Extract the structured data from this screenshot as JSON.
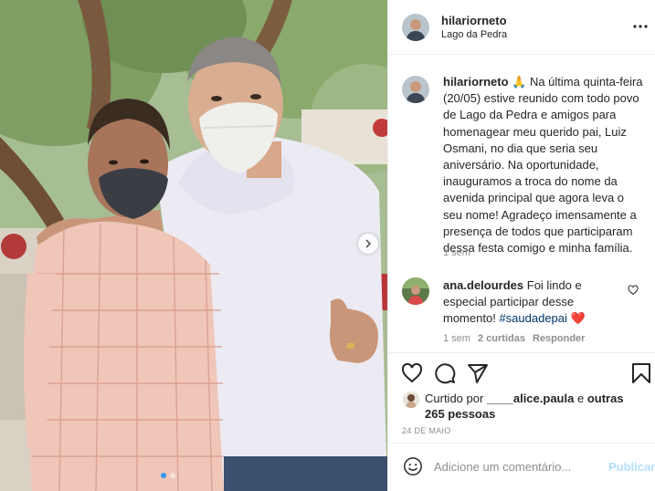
{
  "post": {
    "username": "hilariorneto",
    "location": "Lago da Pedra"
  },
  "caption": {
    "username": "hilariorneto",
    "emoji": "🙏",
    "text": "Na última quinta-feira (20/05) estive reunido com todo povo de Lago da Pedra e amigos para homenagear meu querido pai, Luiz Osmani, no dia que seria seu aniversário. Na oportunidade, inauguramos a troca do nome da avenida principal que agora leva o seu nome! Agradeço imensamente a presença de todos que participaram dessa festa comigo e minha família.",
    "time": "1 sem"
  },
  "comment": {
    "username": "ana.delourdes",
    "text": "Foi lindo e especial participar desse momento!",
    "hashtag": "#saudadepai",
    "emoji": "❤️",
    "time": "1 sem",
    "likes": "2 curtidas",
    "reply": "Responder"
  },
  "likes": {
    "prefix": "Curtido por",
    "user": "____alice.paula",
    "connector": "e",
    "others": "outras 265 pessoas"
  },
  "date": "24 DE MAIO",
  "add_comment": {
    "placeholder": "Adicione um comentário...",
    "publish": "Publicar"
  },
  "icons": {
    "more": "more-horizontal-icon",
    "like": "heart-icon",
    "comment": "comment-icon",
    "share": "paper-plane-icon",
    "save": "bookmark-icon",
    "emoji": "smiley-icon",
    "next": "chevron-right-icon"
  },
  "colors": {
    "link": "#00376b",
    "muted": "#8e8e8e",
    "publish_disabled": "#b2dffc",
    "active_dot": "#3897f0",
    "heart_emoji": "#ed4956"
  }
}
